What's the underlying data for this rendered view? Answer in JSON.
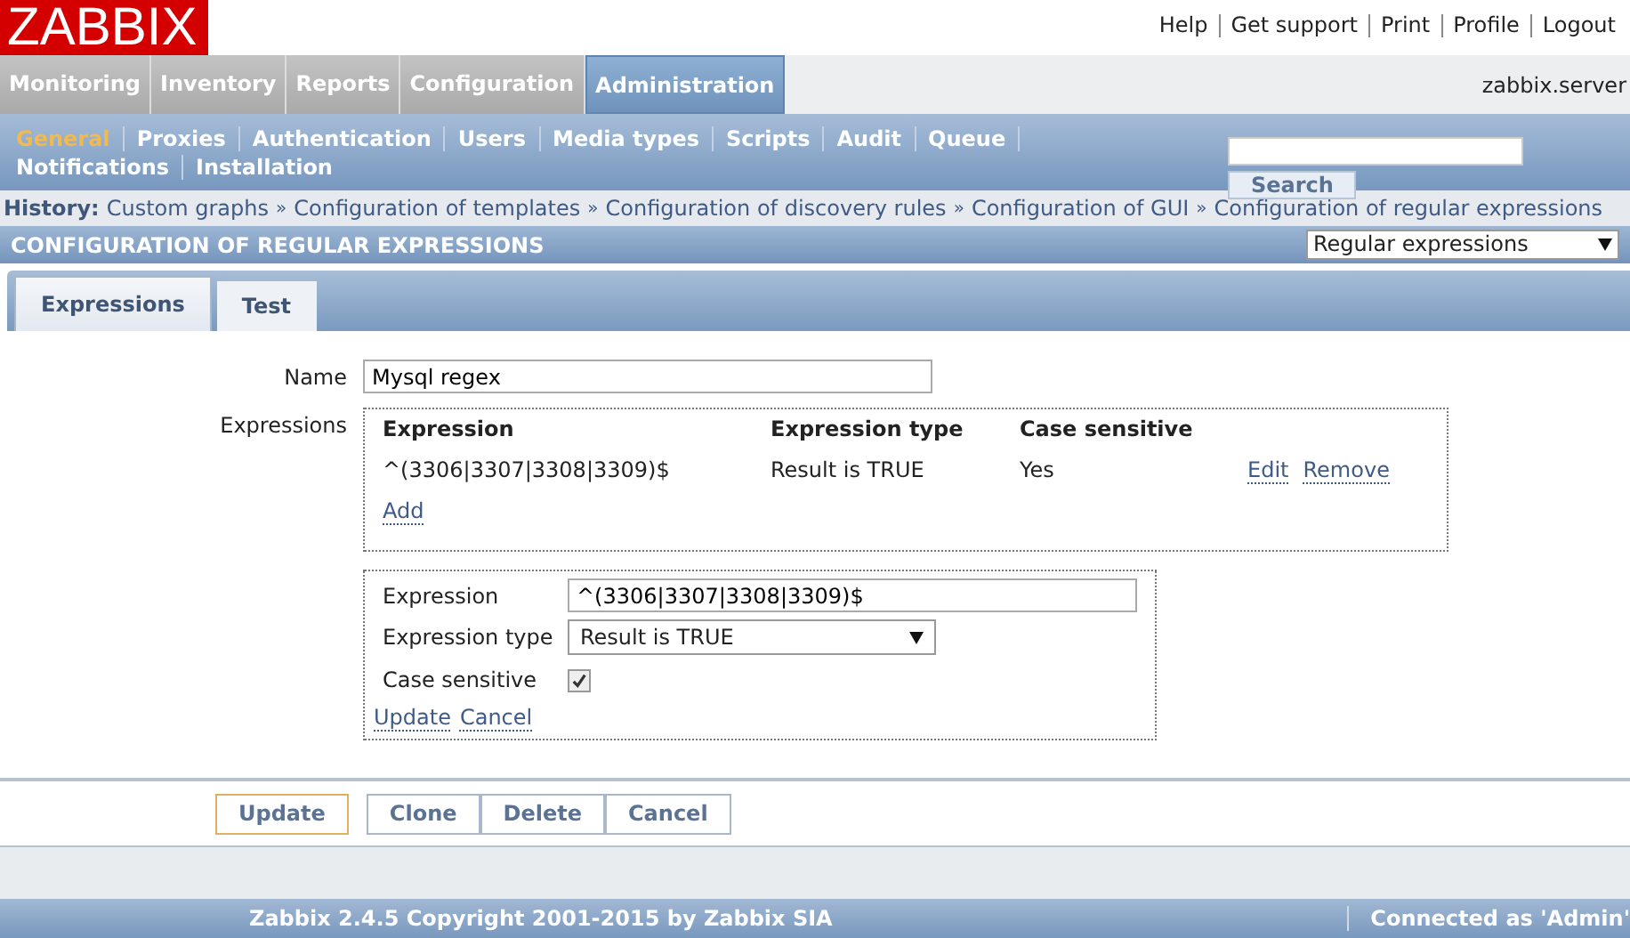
{
  "header": {
    "logo": "ZABBIX",
    "links": [
      "Help",
      "Get support",
      "Print",
      "Profile",
      "Logout"
    ]
  },
  "main_menu": {
    "items": [
      {
        "label": "Monitoring",
        "selected": false
      },
      {
        "label": "Inventory",
        "selected": false
      },
      {
        "label": "Reports",
        "selected": false
      },
      {
        "label": "Configuration",
        "selected": false
      },
      {
        "label": "Administration",
        "selected": true
      }
    ],
    "server": "zabbix.server"
  },
  "sub_menu": {
    "rows": [
      [
        {
          "label": "General",
          "selected": true
        },
        {
          "label": "Proxies",
          "selected": false
        },
        {
          "label": "Authentication",
          "selected": false
        },
        {
          "label": "Users",
          "selected": false
        },
        {
          "label": "Media types",
          "selected": false
        },
        {
          "label": "Scripts",
          "selected": false
        },
        {
          "label": "Audit",
          "selected": false
        },
        {
          "label": "Queue",
          "selected": false
        }
      ],
      [
        {
          "label": "Notifications",
          "selected": false
        },
        {
          "label": "Installation",
          "selected": false
        }
      ]
    ],
    "search_button": "Search"
  },
  "history": {
    "label": "History:",
    "separator": "»",
    "items": [
      "Custom graphs",
      "Configuration of templates",
      "Configuration of discovery rules",
      "Configuration of GUI",
      "Configuration of regular expressions"
    ]
  },
  "title": "CONFIGURATION OF REGULAR EXPRESSIONS",
  "view_select": "Regular expressions",
  "tabs": [
    {
      "label": "Expressions",
      "selected": true
    },
    {
      "label": "Test",
      "selected": false
    }
  ],
  "form": {
    "name": {
      "label": "Name",
      "value": "Mysql regex"
    },
    "expressions": {
      "label": "Expressions",
      "columns": [
        "Expression",
        "Expression type",
        "Case sensitive"
      ],
      "rows": [
        {
          "expression": "^(3306|3307|3308|3309)$",
          "type": "Result is TRUE",
          "case_sensitive": "Yes",
          "actions": [
            "Edit",
            "Remove"
          ]
        }
      ],
      "add": "Add"
    },
    "editor": {
      "expression": {
        "label": "Expression",
        "value": "^(3306|3307|3308|3309)$"
      },
      "type": {
        "label": "Expression type",
        "value": "Result is TRUE"
      },
      "case_sensitive": {
        "label": "Case sensitive",
        "checked": true
      },
      "actions": [
        "Update",
        "Cancel"
      ]
    }
  },
  "buttons": [
    {
      "label": "Update",
      "primary": true
    },
    {
      "label": "Clone",
      "primary": false
    },
    {
      "label": "Delete",
      "primary": false
    },
    {
      "label": "Cancel",
      "primary": false
    }
  ],
  "footer": {
    "copyright": "Zabbix 2.4.5 Copyright 2001-2015 by Zabbix SIA",
    "connected": "Connected as 'Admin'"
  }
}
